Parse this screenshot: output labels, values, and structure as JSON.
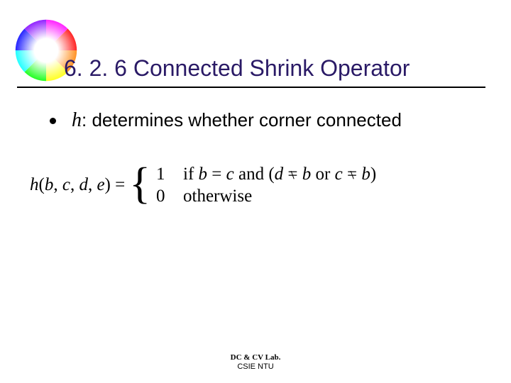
{
  "title": "6. 2. 6 Connected Shrink Operator",
  "bullet": {
    "symbol": "h",
    "text": ": determines whether corner connected"
  },
  "formula": {
    "lhs_prefix": "h",
    "lhs_args": "(b, c, d, e) = ",
    "case1_num": "1",
    "case1_cond_if": "if ",
    "case1_b": "b",
    "case1_eq": " = ",
    "case1_c": "c",
    "case1_and": " and (",
    "case1_d": "d",
    "case1_neq1_eq": "=",
    "case1_b2": " b",
    "case1_or": " or ",
    "case1_c2": "c",
    "case1_neq2_eq": "=",
    "case1_b3": " b",
    "case1_close": ")",
    "case2_num": "0",
    "case2_cond": "otherwise"
  },
  "footer": {
    "lab": "DC & CV Lab.",
    "org": "CSIE NTU"
  }
}
